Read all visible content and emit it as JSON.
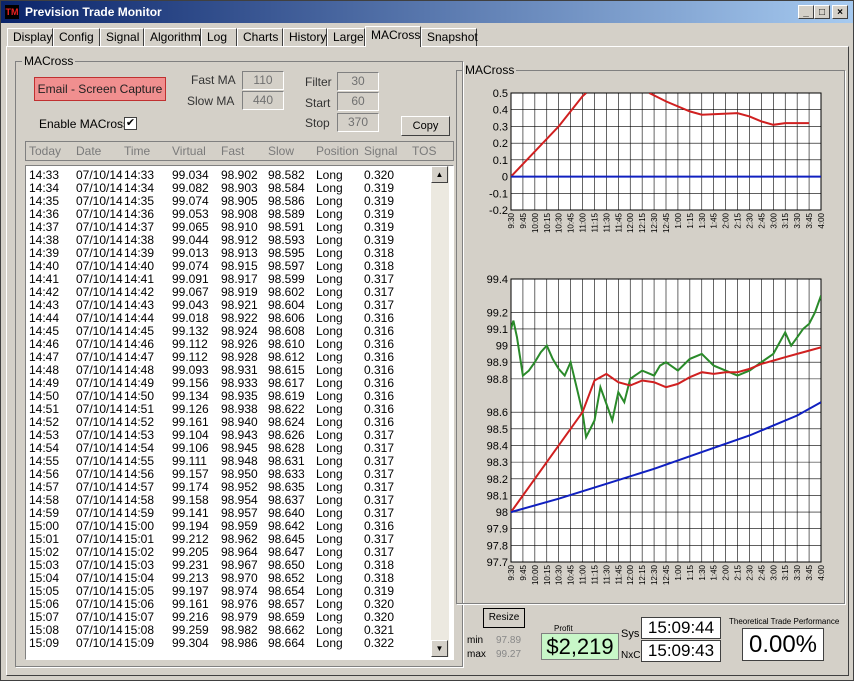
{
  "window": {
    "title": "Prevision Trade Monitor",
    "minimize": "_",
    "maximize": "□",
    "close": "×"
  },
  "tabs": [
    "Display",
    "Config",
    "Signal",
    "Algorithm",
    "Log",
    "Charts",
    "History",
    "Large",
    "MACross",
    "Snapshot"
  ],
  "active_tab": "MACross",
  "left_group": {
    "legend": "MACross",
    "email_button": "Email - Screen Capture",
    "fast_ma_label": "Fast MA",
    "fast_ma_value": "110",
    "slow_ma_label": "Slow MA",
    "slow_ma_value": "440",
    "filter_label": "Filter",
    "filter_value": "30",
    "start_label": "Start",
    "start_value": "60",
    "stop_label": "Stop",
    "stop_value": "370",
    "enable_label": "Enable MACross",
    "enable_checked": "✔",
    "copy_button": "Copy"
  },
  "table": {
    "columns": [
      "Today",
      "Date",
      "Time",
      "Virtual",
      "Fast",
      "Slow",
      "Position",
      "Signal",
      "TOS"
    ],
    "rows": [
      [
        "14:33",
        "07/10/14",
        "14:33",
        "99.034",
        "98.902",
        "98.582",
        "Long",
        "0.320"
      ],
      [
        "14:34",
        "07/10/14",
        "14:34",
        "99.082",
        "98.903",
        "98.584",
        "Long",
        "0.319"
      ],
      [
        "14:35",
        "07/10/14",
        "14:35",
        "99.074",
        "98.905",
        "98.586",
        "Long",
        "0.319"
      ],
      [
        "14:36",
        "07/10/14",
        "14:36",
        "99.053",
        "98.908",
        "98.589",
        "Long",
        "0.319"
      ],
      [
        "14:37",
        "07/10/14",
        "14:37",
        "99.065",
        "98.910",
        "98.591",
        "Long",
        "0.319"
      ],
      [
        "14:38",
        "07/10/14",
        "14:38",
        "99.044",
        "98.912",
        "98.593",
        "Long",
        "0.319"
      ],
      [
        "14:39",
        "07/10/14",
        "14:39",
        "99.013",
        "98.913",
        "98.595",
        "Long",
        "0.318"
      ],
      [
        "14:40",
        "07/10/14",
        "14:40",
        "99.074",
        "98.915",
        "98.597",
        "Long",
        "0.318"
      ],
      [
        "14:41",
        "07/10/14",
        "14:41",
        "99.091",
        "98.917",
        "98.599",
        "Long",
        "0.317"
      ],
      [
        "14:42",
        "07/10/14",
        "14:42",
        "99.067",
        "98.919",
        "98.602",
        "Long",
        "0.317"
      ],
      [
        "14:43",
        "07/10/14",
        "14:43",
        "99.043",
        "98.921",
        "98.604",
        "Long",
        "0.317"
      ],
      [
        "14:44",
        "07/10/14",
        "14:44",
        "99.018",
        "98.922",
        "98.606",
        "Long",
        "0.316"
      ],
      [
        "14:45",
        "07/10/14",
        "14:45",
        "99.132",
        "98.924",
        "98.608",
        "Long",
        "0.316"
      ],
      [
        "14:46",
        "07/10/14",
        "14:46",
        "99.112",
        "98.926",
        "98.610",
        "Long",
        "0.316"
      ],
      [
        "14:47",
        "07/10/14",
        "14:47",
        "99.112",
        "98.928",
        "98.612",
        "Long",
        "0.316"
      ],
      [
        "14:48",
        "07/10/14",
        "14:48",
        "99.093",
        "98.931",
        "98.615",
        "Long",
        "0.316"
      ],
      [
        "14:49",
        "07/10/14",
        "14:49",
        "99.156",
        "98.933",
        "98.617",
        "Long",
        "0.316"
      ],
      [
        "14:50",
        "07/10/14",
        "14:50",
        "99.134",
        "98.935",
        "98.619",
        "Long",
        "0.316"
      ],
      [
        "14:51",
        "07/10/14",
        "14:51",
        "99.126",
        "98.938",
        "98.622",
        "Long",
        "0.316"
      ],
      [
        "14:52",
        "07/10/14",
        "14:52",
        "99.161",
        "98.940",
        "98.624",
        "Long",
        "0.316"
      ],
      [
        "14:53",
        "07/10/14",
        "14:53",
        "99.104",
        "98.943",
        "98.626",
        "Long",
        "0.317"
      ],
      [
        "14:54",
        "07/10/14",
        "14:54",
        "99.106",
        "98.945",
        "98.628",
        "Long",
        "0.317"
      ],
      [
        "14:55",
        "07/10/14",
        "14:55",
        "99.111",
        "98.948",
        "98.631",
        "Long",
        "0.317"
      ],
      [
        "14:56",
        "07/10/14",
        "14:56",
        "99.157",
        "98.950",
        "98.633",
        "Long",
        "0.317"
      ],
      [
        "14:57",
        "07/10/14",
        "14:57",
        "99.174",
        "98.952",
        "98.635",
        "Long",
        "0.317"
      ],
      [
        "14:58",
        "07/10/14",
        "14:58",
        "99.158",
        "98.954",
        "98.637",
        "Long",
        "0.317"
      ],
      [
        "14:59",
        "07/10/14",
        "14:59",
        "99.141",
        "98.957",
        "98.640",
        "Long",
        "0.317"
      ],
      [
        "15:00",
        "07/10/14",
        "15:00",
        "99.194",
        "98.959",
        "98.642",
        "Long",
        "0.316"
      ],
      [
        "15:01",
        "07/10/14",
        "15:01",
        "99.212",
        "98.962",
        "98.645",
        "Long",
        "0.317"
      ],
      [
        "15:02",
        "07/10/14",
        "15:02",
        "99.205",
        "98.964",
        "98.647",
        "Long",
        "0.317"
      ],
      [
        "15:03",
        "07/10/14",
        "15:03",
        "99.231",
        "98.967",
        "98.650",
        "Long",
        "0.318"
      ],
      [
        "15:04",
        "07/10/14",
        "15:04",
        "99.213",
        "98.970",
        "98.652",
        "Long",
        "0.318"
      ],
      [
        "15:05",
        "07/10/14",
        "15:05",
        "99.197",
        "98.974",
        "98.654",
        "Long",
        "0.319"
      ],
      [
        "15:06",
        "07/10/14",
        "15:06",
        "99.161",
        "98.976",
        "98.657",
        "Long",
        "0.320"
      ],
      [
        "15:07",
        "07/10/14",
        "15:07",
        "99.216",
        "98.979",
        "98.659",
        "Long",
        "0.320"
      ],
      [
        "15:08",
        "07/10/14",
        "15:08",
        "99.259",
        "98.982",
        "98.662",
        "Long",
        "0.321"
      ],
      [
        "15:09",
        "07/10/14",
        "15:09",
        "99.304",
        "98.986",
        "98.664",
        "Long",
        "0.322"
      ]
    ]
  },
  "right_group": {
    "legend": "MACross"
  },
  "chart_data": [
    {
      "type": "line",
      "x_ticks": [
        "9:30",
        "9:45",
        "10:00",
        "10:15",
        "10:30",
        "10:45",
        "11:00",
        "11:15",
        "11:30",
        "11:45",
        "12:00",
        "12:15",
        "12:30",
        "12:45",
        "1:00",
        "1:15",
        "1:30",
        "1:45",
        "2:00",
        "2:15",
        "2:30",
        "2:45",
        "3:00",
        "3:15",
        "3:30",
        "3:45",
        "4:00"
      ],
      "y_ticks": [
        "0.5",
        "0.4",
        "0.3",
        "0.2",
        "0.1",
        "0",
        "-0.1",
        "-0.2"
      ],
      "ylim": [
        -0.2,
        0.5
      ],
      "grid": true,
      "series": [
        {
          "color": "#d02020",
          "points": [
            [
              0,
              0
            ],
            [
              4,
              0.3
            ],
            [
              6,
              0.48
            ],
            [
              6.3,
              0.5
            ]
          ],
          "points_b": [
            [
              11.6,
              0.5
            ],
            [
              13,
              0.45
            ],
            [
              15,
              0.39
            ],
            [
              16,
              0.37
            ],
            [
              19,
              0.38
            ],
            [
              20,
              0.36
            ],
            [
              21,
              0.33
            ],
            [
              22,
              0.31
            ],
            [
              23,
              0.32
            ],
            [
              24,
              0.32
            ],
            [
              25,
              0.32
            ]
          ]
        },
        {
          "color": "#1020c0",
          "points": [
            [
              0,
              0
            ],
            [
              26,
              0
            ]
          ]
        }
      ],
      "colors": {
        "signal": "#d02020",
        "zero": "#1020c0"
      }
    },
    {
      "type": "line",
      "x_ticks": [
        "9:30",
        "9:45",
        "10:00",
        "10:15",
        "10:30",
        "10:45",
        "11:00",
        "11:15",
        "11:30",
        "11:45",
        "12:00",
        "12:15",
        "12:30",
        "12:45",
        "1:00",
        "1:15",
        "1:30",
        "1:45",
        "2:00",
        "2:15",
        "2:30",
        "2:45",
        "3:00",
        "3:15",
        "3:30",
        "3:45",
        "4:00"
      ],
      "y_ticks": [
        "99.4",
        "99.2",
        "99.1",
        "99",
        "98.9",
        "98.8",
        "98.6",
        "98.5",
        "98.4",
        "98.3",
        "98.2",
        "98.1",
        "98",
        "97.9",
        "97.8",
        "97.7"
      ],
      "ylim": [
        97.7,
        99.4
      ],
      "grid": true,
      "series": [
        {
          "color": "#2a8a2a",
          "points": [
            [
              0,
              99.1
            ],
            [
              0.2,
              99.15
            ],
            [
              0.5,
              99.05
            ],
            [
              1,
              98.82
            ],
            [
              1.5,
              98.85
            ],
            [
              2,
              98.9
            ],
            [
              2.5,
              98.96
            ],
            [
              3,
              99.0
            ],
            [
              3.5,
              98.92
            ],
            [
              4,
              98.86
            ],
            [
              4.5,
              98.82
            ],
            [
              5,
              98.9
            ],
            [
              5.5,
              98.75
            ],
            [
              6,
              98.6
            ],
            [
              6.3,
              98.45
            ],
            [
              7,
              98.55
            ],
            [
              7.5,
              98.75
            ],
            [
              8,
              98.65
            ],
            [
              8.5,
              98.55
            ],
            [
              9,
              98.72
            ],
            [
              9.5,
              98.66
            ],
            [
              10,
              98.8
            ],
            [
              11,
              98.85
            ],
            [
              12,
              98.82
            ],
            [
              12.5,
              98.88
            ],
            [
              13,
              98.9
            ],
            [
              14,
              98.85
            ],
            [
              15,
              98.92
            ],
            [
              16,
              98.95
            ],
            [
              17,
              98.88
            ],
            [
              18,
              98.85
            ],
            [
              19,
              98.82
            ],
            [
              20,
              98.85
            ],
            [
              21,
              98.9
            ],
            [
              22,
              98.95
            ],
            [
              23,
              99.08
            ],
            [
              23.5,
              99.0
            ],
            [
              24,
              99.05
            ],
            [
              24.5,
              99.1
            ],
            [
              25,
              99.13
            ],
            [
              25.5,
              99.2
            ],
            [
              26,
              99.3
            ]
          ]
        },
        {
          "color": "#d02020",
          "points": [
            [
              0,
              98.0
            ],
            [
              3,
              98.3
            ],
            [
              6,
              98.6
            ],
            [
              7,
              98.79
            ],
            [
              8,
              98.83
            ],
            [
              9,
              98.78
            ],
            [
              10,
              98.76
            ],
            [
              11,
              98.79
            ],
            [
              12,
              98.78
            ],
            [
              13,
              98.75
            ],
            [
              14,
              98.77
            ],
            [
              15,
              98.81
            ],
            [
              16,
              98.84
            ],
            [
              17,
              98.83
            ],
            [
              18,
              98.84
            ],
            [
              19,
              98.84
            ],
            [
              20,
              98.86
            ],
            [
              21,
              98.89
            ],
            [
              22,
              98.91
            ],
            [
              23,
              98.93
            ],
            [
              24,
              98.95
            ],
            [
              25,
              98.97
            ],
            [
              26,
              98.99
            ]
          ]
        },
        {
          "color": "#1020c0",
          "points": [
            [
              0,
              98.0
            ],
            [
              4,
              98.08
            ],
            [
              8,
              98.17
            ],
            [
              12,
              98.26
            ],
            [
              16,
              98.36
            ],
            [
              20,
              98.46
            ],
            [
              24,
              98.58
            ],
            [
              26,
              98.66
            ]
          ]
        }
      ]
    }
  ],
  "bottom": {
    "resize_button": "Resize",
    "min_label": "min",
    "min_value": "97.89",
    "max_label": "max",
    "max_value": "99.27",
    "profit_label": "Profit",
    "profit_value": "$2,219",
    "sys_label": "Sys",
    "sys_time": "15:09:44",
    "nxc_label": "NxC",
    "nxc_time": "15:09:43",
    "perf_label": "Theoretical Trade Performance",
    "perf_value": "0.00%"
  }
}
